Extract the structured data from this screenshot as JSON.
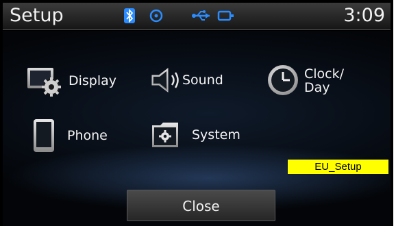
{
  "header": {
    "title": "Setup",
    "time": "3:09"
  },
  "status_icons": [
    "bluetooth-icon",
    "disc-icon",
    "usb-icon",
    "aux-plug-icon"
  ],
  "menu": {
    "display": "Display",
    "sound": "Sound",
    "clock_line1": "Clock/",
    "clock_line2": "Day",
    "phone": "Phone",
    "system": "System"
  },
  "badge": "EU_Setup",
  "close_label": "Close",
  "colors": {
    "accent": "#2a8cff",
    "badge": "#ffff00",
    "background": "#000000"
  }
}
